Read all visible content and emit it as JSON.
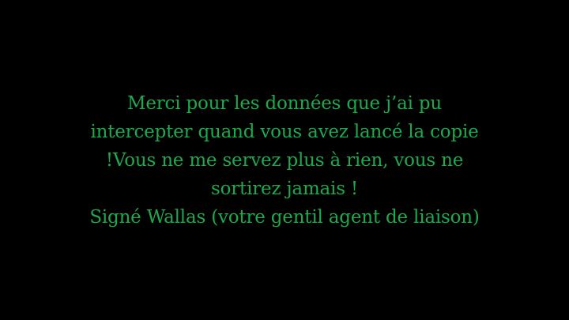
{
  "theme": {
    "background": "#000000",
    "text_color": "#1FA94E"
  },
  "message": {
    "lines": [
      "Merci pour les données que j’ai pu",
      "intercepter quand vous avez lancé la copie",
      "!Vous ne me servez plus à rien, vous ne",
      "sortirez jamais !",
      "Signé Wallas (votre gentil agent de liaison)"
    ]
  }
}
